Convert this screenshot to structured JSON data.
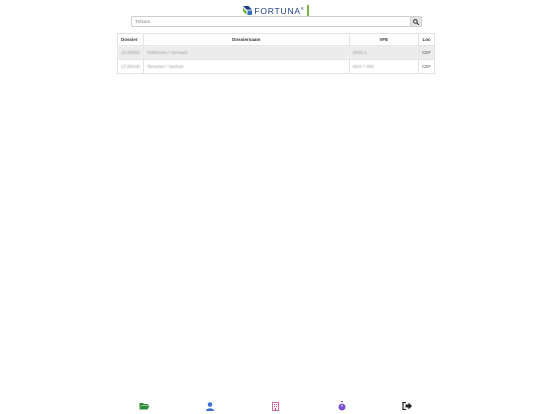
{
  "header": {
    "logo_text": "FORTUNA",
    "logo_reg": "®"
  },
  "search": {
    "placeholder": "Trézum",
    "button_icon": "search-icon"
  },
  "table": {
    "columns": [
      "Dossier",
      "Dossiernaam",
      "VFE",
      "Loc"
    ],
    "rows": [
      {
        "dossier": "19.00000",
        "naam": "Pelletroen / Vervuen",
        "vfe": "0000-1",
        "loc": "CEF"
      },
      {
        "dossier": "17.00100",
        "naam": "Tervuren / Vanhoe",
        "vfe": "00/4 7 000",
        "loc": "CEF"
      }
    ]
  },
  "bottom_nav": [
    {
      "icon": "folder-open-icon",
      "color": "#2e8b3a"
    },
    {
      "icon": "user-icon",
      "color": "#3b6fd4"
    },
    {
      "icon": "building-icon",
      "color": "#c2478a"
    },
    {
      "icon": "stopwatch-icon",
      "color": "#7b4fc9"
    },
    {
      "icon": "sign-out-icon",
      "color": "#222222"
    }
  ]
}
